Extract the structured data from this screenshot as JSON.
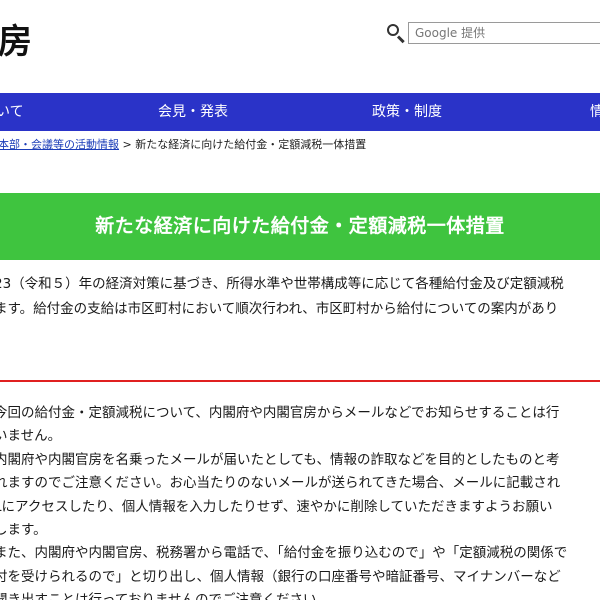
{
  "header": {
    "logo_text": "房",
    "search_placeholder": "Google 提供"
  },
  "nav": {
    "items": [
      {
        "label": "いて"
      },
      {
        "label": "会見・発表"
      },
      {
        "label": "政策・制度"
      },
      {
        "label": "情"
      }
    ]
  },
  "breadcrumb": {
    "parent": "本部・会議等の活動情報",
    "separator": " > ",
    "current": "新たな経済に向けた給付金・定額減税一体措置"
  },
  "page_title": "新たな経済に向けた給付金・定額減税一体措置",
  "lead": {
    "line1": "23（令和５）年の経済対策に基づき、所得水準や世帯構成等に応じて各種給付金及び定額減税",
    "line2": "ます。給付金の支給は市区町村において順次行われ、市区町村から給付についての案内があり"
  },
  "colors": {
    "nav_bg": "#2a33c8",
    "banner_bg": "#3fc43f",
    "divider": "#e02020",
    "link": "#1a3cb8"
  },
  "notice": {
    "lines": [
      "今回の給付金・定額減税について、内閣府や内閣官房からメールなどでお知らせすることは行",
      "いません。",
      "内閣府や内閣官房を名乗ったメールが届いたとしても、情報の詐取などを目的としたものと考",
      "れますのでご注意ください。お心当たりのないメールが送られてきた場合、メールに記載され",
      "Lにアクセスしたり、個人情報を入力したりせず、速やかに削除していただきますようお願い",
      "します。",
      "また、内閣府や内閣官房、税務署から電話で、「給付金を振り込むので」や「定額減税の関係で",
      "付を受けられるので」と切り出し、個人情報（銀行の口座番号や暗証番号、マイナンバーなど",
      "聞き出すことは行っておりませんのでご注意ください。"
    ]
  }
}
